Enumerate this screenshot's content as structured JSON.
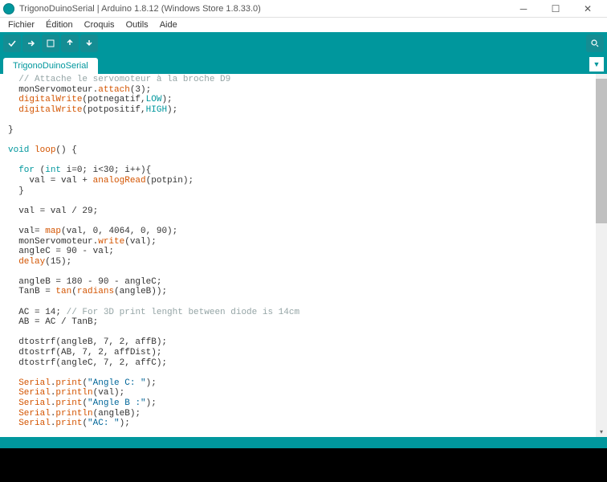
{
  "titlebar": {
    "text": "TrigonoDuinoSerial | Arduino 1.8.12 (Windows Store 1.8.33.0)"
  },
  "menu": {
    "file": "Fichier",
    "edit": "Édition",
    "sketch": "Croquis",
    "tools": "Outils",
    "help": "Aide"
  },
  "tab": {
    "name": "TrigonoDuinoSerial"
  },
  "code": {
    "line1_cmt": "  // Attache le servomoteur à la broche D9",
    "line2_pre": "  monServomoteur.",
    "line2_fn": "attach",
    "line2_post": "(3);",
    "line3_pre": "  ",
    "line3_fn": "digitalWrite",
    "line3_mid": "(potnegatif,",
    "line3_const": "LOW",
    "line3_post": ");",
    "line4_pre": "  ",
    "line4_fn": "digitalWrite",
    "line4_mid": "(potpositif,",
    "line4_const": "HIGH",
    "line4_post": ");",
    "line6": "}",
    "line8_kw": "void",
    "line8_post": " ",
    "line8_fn": "loop",
    "line8_end": "() {",
    "line10_pre": "  ",
    "line10_kw1": "for",
    "line10_mid1": " (",
    "line10_kw2": "int",
    "line10_post": " i=0; i<30; i++){",
    "line11_pre": "    val = val + ",
    "line11_fn": "analogRead",
    "line11_post": "(potpin);",
    "line12": "  }",
    "line14": "  val = val / 29;",
    "line16_pre": "  val= ",
    "line16_fn": "map",
    "line16_post": "(val, 0, 4064, 0, 90);",
    "line17_pre": "  monServomoteur.",
    "line17_fn": "write",
    "line17_post": "(val);",
    "line18": "  angleC = 90 - val;",
    "line19_pre": "  ",
    "line19_fn": "delay",
    "line19_post": "(15);",
    "line21": "  angleB = 180 - 90 - angleC;",
    "line22_pre": "  TanB = ",
    "line22_fn1": "tan",
    "line22_mid": "(",
    "line22_fn2": "radians",
    "line22_post": "(angleB));",
    "line24_pre": "  AC = 14; ",
    "line24_cmt": "// For 3D print lenght between diode is 14cm",
    "line25": "  AB = AC / TanB;",
    "line27": "  dtostrf(angleB, 7, 2, affB);",
    "line28": "  dtostrf(AB, 7, 2, affDist);",
    "line29": "  dtostrf(angleC, 7, 2, affC);",
    "line31_obj": "Serial",
    "line31_pre": "  ",
    "line31_fn": "print",
    "line31_mid": "(",
    "line31_str": "\"Angle C: \"",
    "line31_post": ");",
    "line32_pre": "  ",
    "line32_fn": "println",
    "line32_post": "(val);",
    "line33_pre": "  ",
    "line33_fn": "print",
    "line33_mid": "(",
    "line33_str": "\"Angle B :\"",
    "line33_post": ");",
    "line34_pre": "  ",
    "line34_fn": "println",
    "line34_post": "(angleB);",
    "line35_pre": "  ",
    "line35_fn": "print",
    "line35_mid": "(",
    "line35_str": "\"AC: \"",
    "line35_post": ");"
  }
}
